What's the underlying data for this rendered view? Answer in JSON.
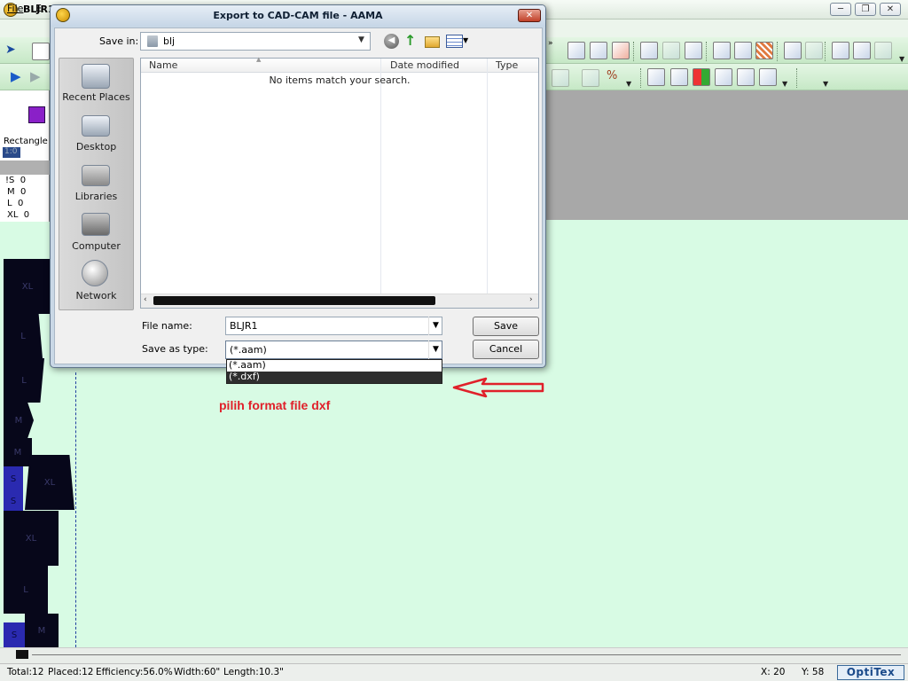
{
  "app": {
    "title": "BLJR1",
    "window_controls": [
      "─",
      "❐",
      "✕"
    ],
    "menu": [
      "File",
      "E"
    ]
  },
  "left_panel": {
    "shape_color": "#8a20c8",
    "shape_name": "Rectangle",
    "scale": "1:0",
    "sizes": [
      {
        "size": "!S",
        "count": "0"
      },
      {
        "size": "M",
        "count": "0"
      },
      {
        "size": "L",
        "count": "0"
      },
      {
        "size": "XL",
        "count": "0"
      }
    ]
  },
  "pieces": [
    {
      "label": "XL"
    },
    {
      "label": "L"
    },
    {
      "label": "L"
    },
    {
      "label": "M"
    },
    {
      "label": "M"
    },
    {
      "label": "S"
    },
    {
      "label": "S"
    },
    {
      "label": "XL"
    },
    {
      "label": "XL"
    },
    {
      "label": "L"
    },
    {
      "label": "M"
    },
    {
      "label": "S"
    }
  ],
  "statusbar": {
    "total": "Total:12",
    "placed": "Placed:12",
    "efficiency": "Efficiency:56.0%",
    "width": "Width:60\"",
    "length": "Length:10.3\"",
    "x": "X: 20",
    "y": "Y: 58",
    "brand": "OptiTex"
  },
  "dialog": {
    "title": "Export to CAD-CAM file - AAMA",
    "close": "✕",
    "save_in_label": "Save in:",
    "save_in_value": "blj",
    "places": [
      "Recent Places",
      "Desktop",
      "Libraries",
      "Computer",
      "Network"
    ],
    "columns": [
      "Name",
      "Date modified",
      "Type"
    ],
    "empty_message": "No items match your search.",
    "file_name_label": "File name:",
    "file_name_value": "BLJR1",
    "save_as_type_label": "Save as type:",
    "save_as_type_value": "(*.aam)",
    "type_options": [
      "(*.aam)",
      "(*.dxf)"
    ],
    "selected_type_index": 1,
    "save_button": "Save",
    "cancel_button": "Cancel"
  },
  "annotation": {
    "text": "pilih format file dxf",
    "color": "#e0202a"
  },
  "colors": {
    "workspace": "#d8fbe4",
    "piece": "#07071a",
    "piece_highlight": "#2a2ab0"
  }
}
